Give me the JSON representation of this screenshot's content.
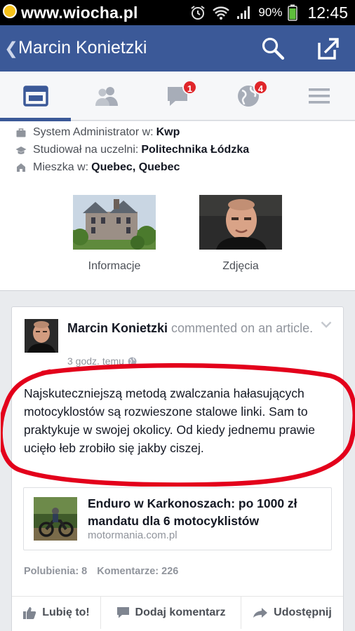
{
  "watermark": {
    "text": "www.wiocha.pl"
  },
  "statusbar": {
    "battery": "90%",
    "time": "12:45"
  },
  "header": {
    "title": "Marcin Konietzki",
    "back_icon": "chevron-left-icon"
  },
  "tabs": [
    {
      "name": "timeline",
      "icon": "timeline-icon",
      "active": true
    },
    {
      "name": "friends",
      "icon": "friends-icon"
    },
    {
      "name": "messages",
      "icon": "chat-icon",
      "badge": "1"
    },
    {
      "name": "notifications",
      "icon": "globe-icon",
      "badge": "4"
    },
    {
      "name": "more",
      "icon": "menu-icon"
    }
  ],
  "about": {
    "work_prefix": "System Administrator w:",
    "work_value": "Kwp",
    "edu_prefix": "Studiował na uczelni:",
    "edu_value": "Politechnika Łódzka",
    "home_prefix": "Mieszka w:",
    "home_value": "Quebec, Quebec",
    "info_label": "Informacje",
    "photos_label": "Zdjęcia"
  },
  "post": {
    "author": "Marcin Konietzki",
    "action_text": "commented on an article.",
    "time": "3 godz. temu",
    "body": "Najskuteczniejszą metodą zwalczania hałasujących motocyklostów są rozwieszone stalowe linki. Sam to praktykuje w swojej okolicy. Od kiedy jednemu prawie ucięło łeb zrobiło się jakby ciszej.",
    "link_title": "Enduro w Karkonoszach: po 1000 zł mandatu dla 6 motocyklistów",
    "link_domain": "motormania.com.pl",
    "likes": "Polubienia: 8",
    "comments": "Komentarze: 226",
    "like_label": "Lubię to!",
    "comment_label": "Dodaj komentarz",
    "share_label": "Udostępnij"
  },
  "colors": {
    "brand": "#3b5998",
    "badge": "#e0262a",
    "highlight_oval": "#e3001b"
  }
}
